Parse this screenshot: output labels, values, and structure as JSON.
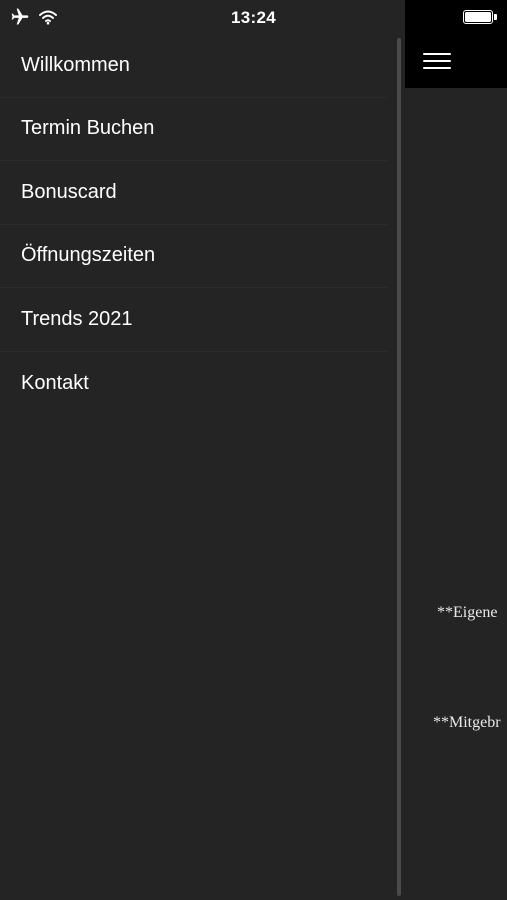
{
  "status_bar": {
    "time": "13:24",
    "icons": [
      "airplane-icon",
      "wifi-icon",
      "battery-icon"
    ]
  },
  "drawer": {
    "menu_items": [
      {
        "label": "Willkommen"
      },
      {
        "label": "Termin Buchen"
      },
      {
        "label": "Bonuscard"
      },
      {
        "label": "Öffnungszeiten"
      },
      {
        "label": "Trends 2021"
      },
      {
        "label": "Kontakt"
      }
    ]
  },
  "main": {
    "menu_icon": "hamburger-menu-icon",
    "text_1": "**Eigene",
    "text_2": "**Mitgebr"
  },
  "colors": {
    "drawer_background": "#242424",
    "header_background": "#000000",
    "text": "#ffffff"
  }
}
